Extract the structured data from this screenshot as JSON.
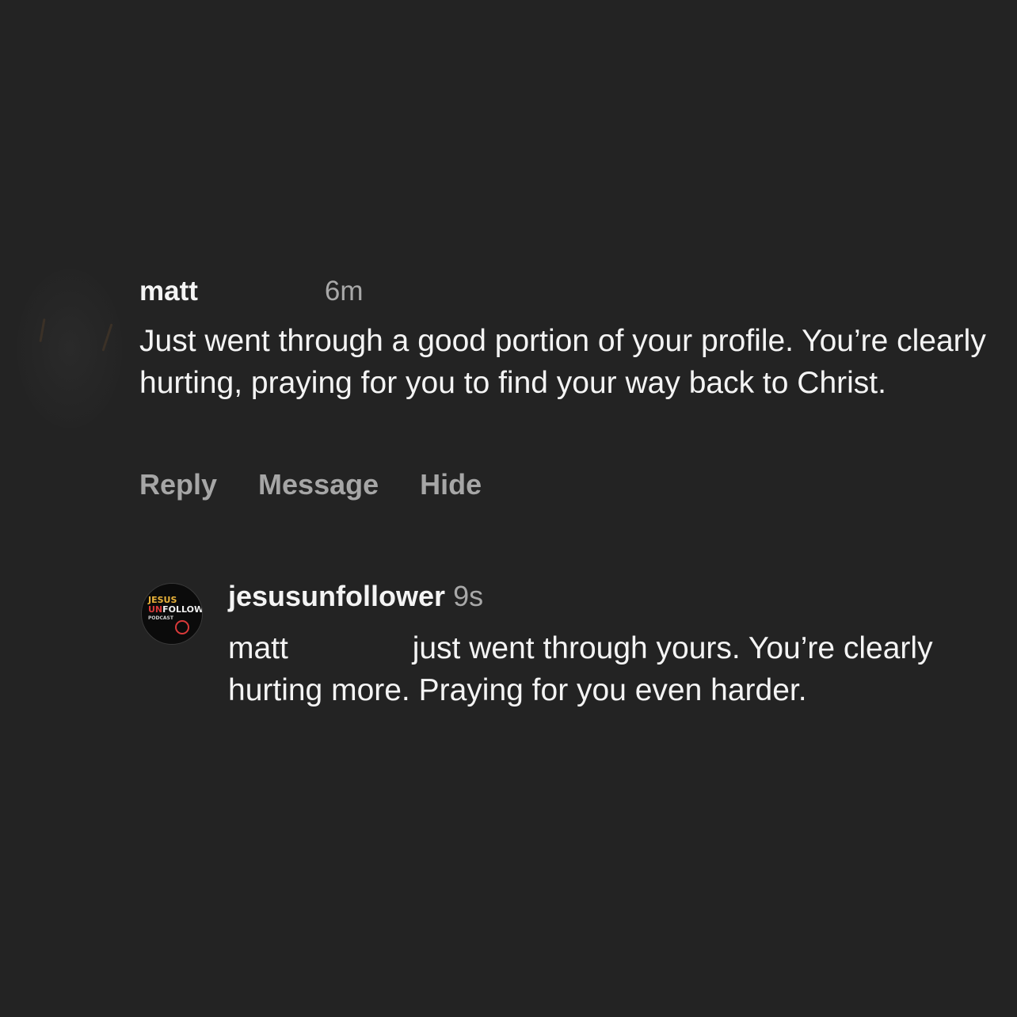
{
  "comments": [
    {
      "username": "matt",
      "time": "6m",
      "text": "Just went through a good portion of your profile. You’re clearly hurting, praying for you to find your way back to Christ.",
      "actions": {
        "reply": "Reply",
        "message": "Message",
        "hide": "Hide"
      }
    },
    {
      "username": "jesusunfollower",
      "time": "9s",
      "mention": "matt",
      "text": "just went through yours. You’re clearly hurting more. Praying for you even harder.",
      "avatar_logo": {
        "line1": "JESUS",
        "line2_a": "UN",
        "line2_b": "FOLLOWER",
        "line3": "PODCAST"
      }
    }
  ],
  "colors": {
    "background": "#232323",
    "primary_text": "#f4f4f4",
    "secondary_text": "#a8a8a8",
    "logo_red": "#d93a3a",
    "logo_gold": "#e8b23a"
  }
}
